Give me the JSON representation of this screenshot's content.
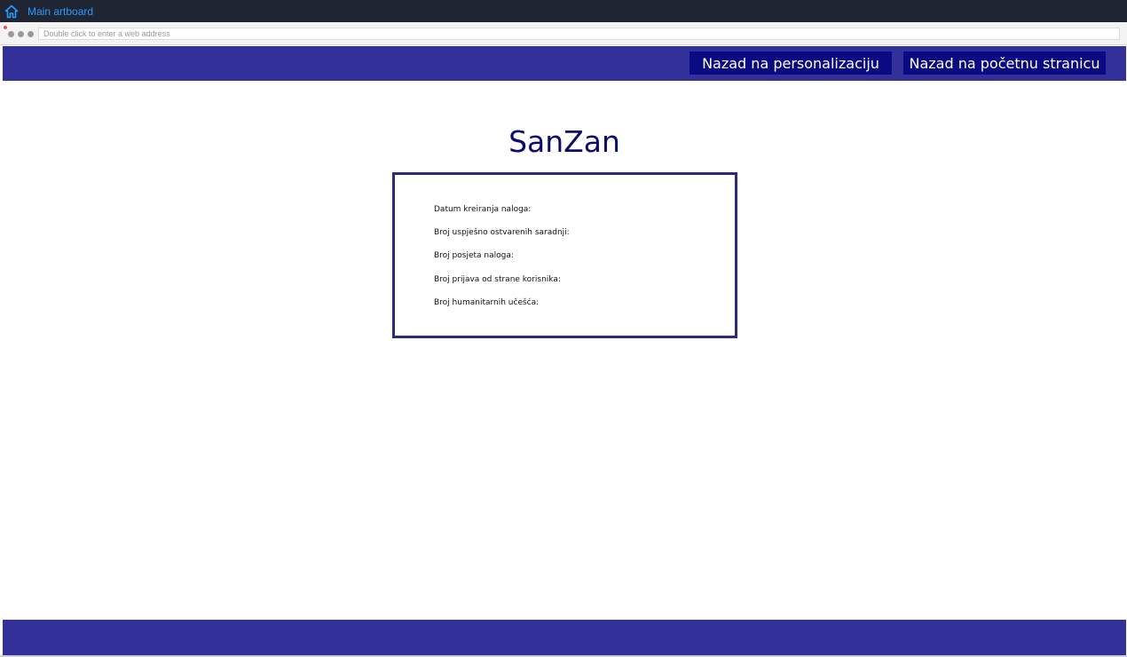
{
  "app_bar": {
    "title": "Main artboard",
    "icon": "home-icon",
    "accent_color": "#2a9bff"
  },
  "browser": {
    "address_placeholder": "Double click to enter a web address"
  },
  "header": {
    "buttons": [
      {
        "label": "Nazad na personalizaciju"
      },
      {
        "label": "Nazad na početnu stranicu"
      }
    ],
    "background_color": "#33309a",
    "button_color": "#0a0a82"
  },
  "main": {
    "site_title": "SanZan",
    "stats": [
      {
        "label": "Datum kreiranja naloga:"
      },
      {
        "label": "Broj uspješno ostvarenih saradnji:"
      },
      {
        "label": "Broj posjeta naloga:"
      },
      {
        "label": "Broj prijava od strane korisnika:"
      },
      {
        "label": "Broj humanitarnih učešća:"
      }
    ]
  }
}
